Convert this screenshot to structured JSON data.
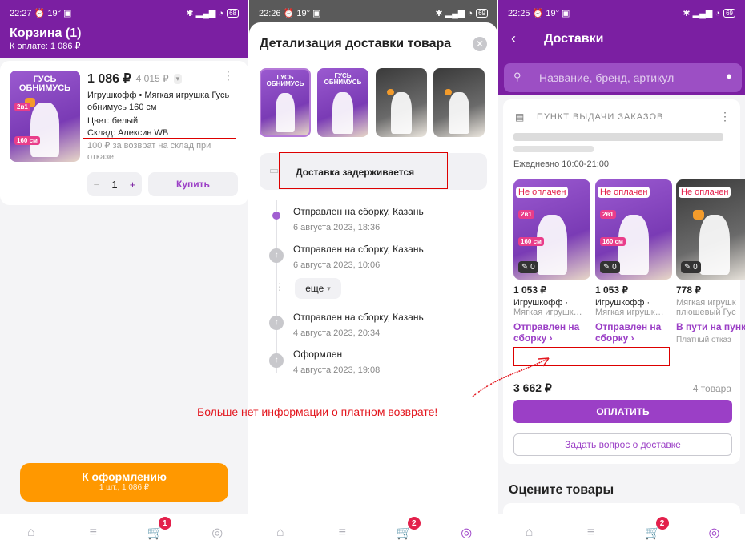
{
  "panel1": {
    "status_time": "22:27",
    "status_temp": "19°",
    "status_battery": "68",
    "title": "Корзина (1)",
    "to_pay": "К оплате: 1 086 ₽",
    "product": {
      "image_title": "ГУСЬ ОБНИМУСЬ",
      "image_tag": "2в1",
      "image_size": "160 см",
      "price": "1 086 ₽",
      "old_price": "4 015 ₽",
      "name": "Игрушкофф • Мягкая игрушка Гусь обнимусь 160 см",
      "color": "Цвет: белый",
      "warehouse": "Склад: Алексин WB",
      "return_fee": "100 ₽ за возврат на склад при отказе",
      "qty": "1",
      "buy_label": "Купить"
    },
    "checkout_label": "К оформлению",
    "checkout_sub": "1 шт., 1 086 ₽",
    "cart_badge": "1"
  },
  "panel2": {
    "status_time": "22:26",
    "status_temp": "19°",
    "status_battery": "69",
    "title": "Детализация доставки товара",
    "delay_text": "Доставка задерживается",
    "more_label": "еще",
    "steps": [
      {
        "text": "Отправлен на сборку, Казань",
        "date": "6 августа 2023, 18:36"
      },
      {
        "text": "Отправлен на сборку, Казань",
        "date": "6 августа 2023, 10:06"
      },
      {
        "text": "Отправлен на сборку, Казань",
        "date": "4 августа 2023, 20:34"
      },
      {
        "text": "Оформлен",
        "date": "4 августа 2023, 19:08"
      }
    ],
    "cart_badge": "2"
  },
  "panel3": {
    "status_time": "22:25",
    "status_temp": "19°",
    "status_battery": "69",
    "title": "Доставки",
    "search_placeholder": "Название, бренд, артикул",
    "pickup_label": "ПУНКТ ВЫДАЧИ ЗАКАЗОВ",
    "hours": "Ежедневно 10:00-21:00",
    "items": [
      {
        "badge": "Не оплачен",
        "price": "1 053 ₽",
        "brand": "Игрушкофф ·",
        "desc": "Мягкая игрушк…",
        "status": "Отправлен на сборку ›",
        "note": "",
        "edit_count": "0"
      },
      {
        "badge": "Не оплачен",
        "price": "1 053 ₽",
        "brand": "Игрушкофф ·",
        "desc": "Мягкая игрушк…",
        "status": "Отправлен на сборку ›",
        "note": "",
        "edit_count": "0"
      },
      {
        "badge": "Не оплачен",
        "price": "778 ₽",
        "brand": "Мягкая игрушк",
        "desc": "плюшевый Гус",
        "status": "В пути на пунк выдачи ›",
        "note": "Платный отказ",
        "edit_count": "0"
      }
    ],
    "total": "3 662 ₽",
    "count": "4 товара",
    "pay_label": "ОПЛАТИТЬ",
    "ask_label": "Задать вопрос о доставке",
    "rate_title": "Оцените товары",
    "cart_badge": "2"
  },
  "annotation": "Больше нет информации о платном возврате!"
}
